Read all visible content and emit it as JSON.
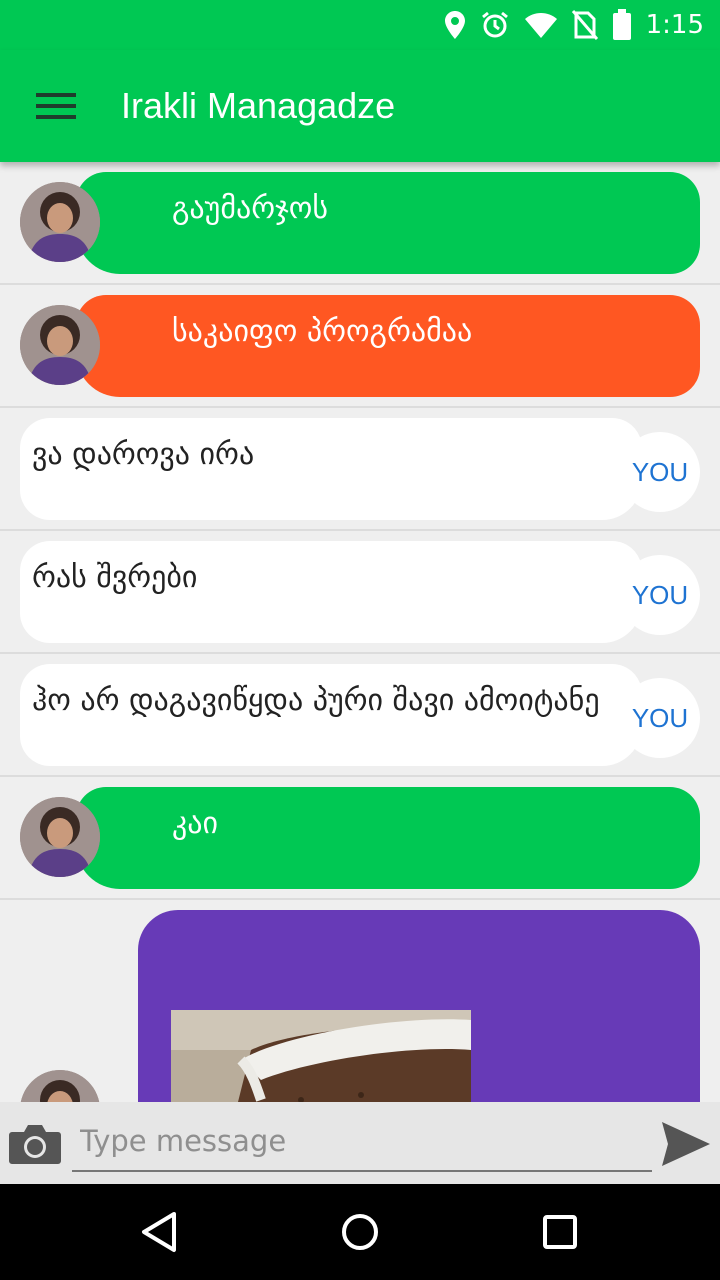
{
  "status_bar": {
    "time": "1:15",
    "icons": [
      "location-icon",
      "alarm-icon",
      "wifi-icon",
      "no-sim-icon",
      "battery-icon"
    ]
  },
  "app_bar": {
    "title": "Irakli Managadze",
    "menu_icon": "hamburger-menu-icon"
  },
  "messages": [
    {
      "sender": "them",
      "text": "გაუმარჯოს",
      "color": "#00c853"
    },
    {
      "sender": "them",
      "text": "საკაიფო პროგრამაა",
      "color": "#ff5722"
    },
    {
      "sender": "me",
      "text": "ვა დაროვა ირა",
      "badge": "YOU"
    },
    {
      "sender": "me",
      "text": "რას შვრები",
      "badge": "YOU"
    },
    {
      "sender": "me",
      "text": "ჰო არ დაგავიწყდა პური შავი ამოიტანე",
      "badge": "YOU"
    },
    {
      "sender": "them",
      "text": "კაი",
      "color": "#00c853"
    },
    {
      "sender": "them",
      "type": "image",
      "image": "cake-photo",
      "color": "#673ab7"
    }
  ],
  "composer": {
    "placeholder": "Type message",
    "value": "",
    "camera_icon": "camera-icon",
    "send_icon": "send-icon"
  },
  "nav_bar": {
    "buttons": [
      "back-icon",
      "home-icon",
      "recents-icon"
    ]
  },
  "colors": {
    "primary": "#00c853",
    "title_text": "#ffffff",
    "you_badge_text": "#1e73d2"
  }
}
